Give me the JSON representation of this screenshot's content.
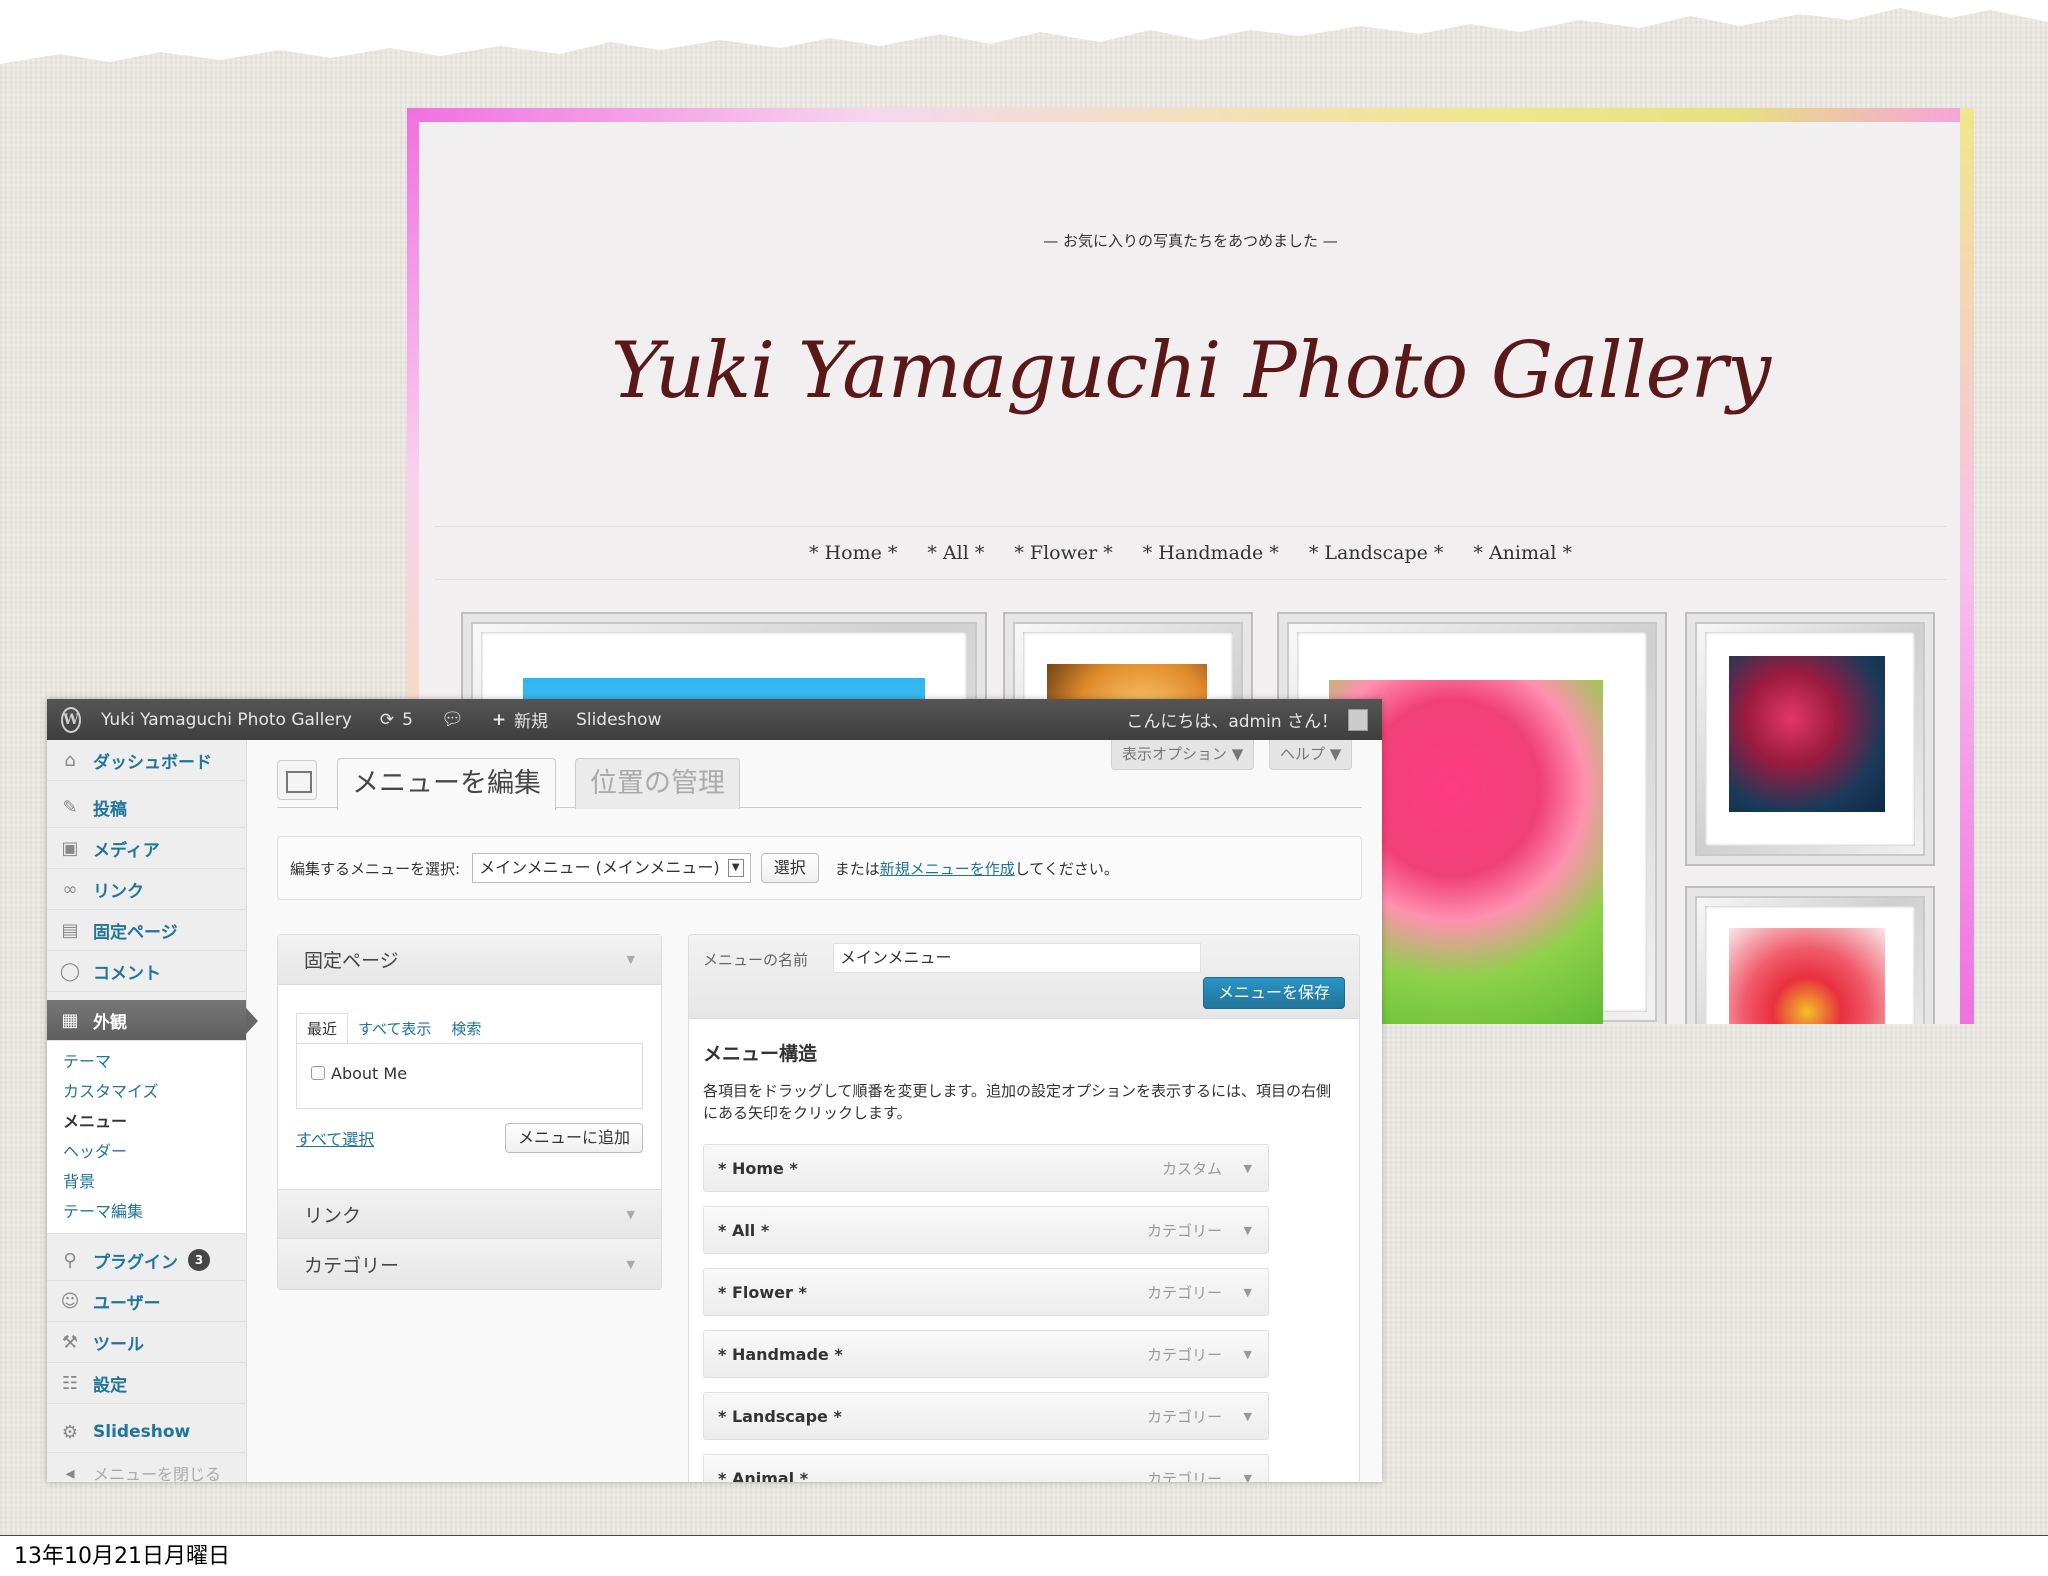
{
  "site": {
    "tagline": "— お気に入りの写真たちをあつめました —",
    "title": "Yuki Yamaguchi Photo Gallery",
    "nav": [
      "* Home *",
      "* All *",
      "* Flower *",
      "* Handmade *",
      "* Landscape *",
      "* Animal *"
    ]
  },
  "adminbar": {
    "site_name": "Yuki Yamaguchi Photo Gallery",
    "updates": "5",
    "new_label": "新規",
    "slideshow": "Slideshow",
    "greeting": "こんにちは、admin さん！"
  },
  "sidebar": {
    "items": [
      {
        "label": "ダッシュボード",
        "icon": "home-icon"
      },
      {
        "label": "投稿",
        "icon": "pin-icon"
      },
      {
        "label": "メディア",
        "icon": "media-icon"
      },
      {
        "label": "リンク",
        "icon": "link-icon"
      },
      {
        "label": "固定ページ",
        "icon": "page-icon"
      },
      {
        "label": "コメント",
        "icon": "comment-icon"
      },
      {
        "label": "外観",
        "icon": "appearance-icon"
      }
    ],
    "submenu": [
      "テーマ",
      "カスタマイズ",
      "メニュー",
      "ヘッダー",
      "背景",
      "テーマ編集"
    ],
    "lower": [
      {
        "label": "プラグイン",
        "icon": "plugin-icon",
        "badge": "3"
      },
      {
        "label": "ユーザー",
        "icon": "users-icon"
      },
      {
        "label": "ツール",
        "icon": "tools-icon"
      },
      {
        "label": "設定",
        "icon": "settings-icon"
      },
      {
        "label": "Slideshow",
        "icon": "gear-icon"
      }
    ],
    "collapse": "メニューを閉じる"
  },
  "screen_options": "表示オプション ▼",
  "help": "ヘルプ ▼",
  "tabs": {
    "edit": "メニューを編集",
    "locations": "位置の管理"
  },
  "select_bar": {
    "label": "編集するメニューを選択:",
    "selected": "メインメニュー (メインメニュー)",
    "button": "選択",
    "or": "または",
    "create_link": "新規メニューを作成",
    "suffix": "してください。"
  },
  "left_panel": {
    "pages_title": "固定ページ",
    "subtabs": [
      "最近",
      "すべて表示",
      "検索"
    ],
    "page_item": "About Me",
    "select_all": "すべて選択",
    "add_button": "メニューに追加",
    "links_title": "リンク",
    "categories_title": "カテゴリー"
  },
  "menu_editor": {
    "name_label": "メニューの名前",
    "name_value": "メインメニュー",
    "save_button": "メニューを保存",
    "structure_title": "メニュー構造",
    "structure_help": "各項目をドラッグして順番を変更します。追加の設定オプションを表示するには、項目の右側にある矢印をクリックします。",
    "items": [
      {
        "label": "* Home *",
        "type": "カスタム"
      },
      {
        "label": "* All *",
        "type": "カテゴリー"
      },
      {
        "label": "* Flower *",
        "type": "カテゴリー"
      },
      {
        "label": "* Handmade *",
        "type": "カテゴリー"
      },
      {
        "label": "* Landscape *",
        "type": "カテゴリー"
      },
      {
        "label": "* Animal *",
        "type": "カテゴリー"
      }
    ]
  },
  "caption": "13年10月21日月曜日"
}
